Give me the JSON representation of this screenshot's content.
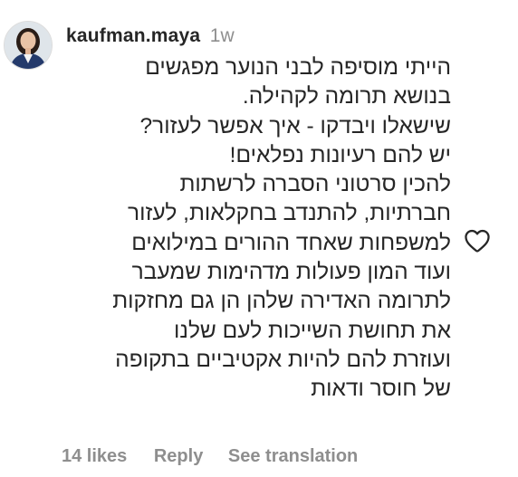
{
  "comment": {
    "username": "kaufman.maya",
    "time_ago": "1w",
    "body_lines": [
      "הייתי מוסיפה לבני הנוער מפגשים",
      "בנושא תרומה לקהילה.",
      "שישאלו ויבדקו - איך אפשר לעזור?",
      "יש להם רעיונות נפלאים!",
      "להכין סרטוני הסברה לרשתות",
      "חברתיות, להתנדב בחקלאות, לעזור",
      "למשפחות שאחד ההורים במילואים",
      "ועוד המון פעולות מדהימות שמעבר",
      "לתרומה האדירה שלהן הן גם מחזקות",
      "את תחושת השייכות לעם שלנו",
      "ועוזרת להם להיות אקטיביים בתקופה",
      "של חוסר ודאות"
    ],
    "footer": {
      "likes": "14 likes",
      "reply": "Reply",
      "see_translation": "See translation"
    },
    "icons": {
      "like": "heart-outline-icon"
    },
    "colors": {
      "text": "#262626",
      "secondary": "#8e8e8e"
    }
  }
}
